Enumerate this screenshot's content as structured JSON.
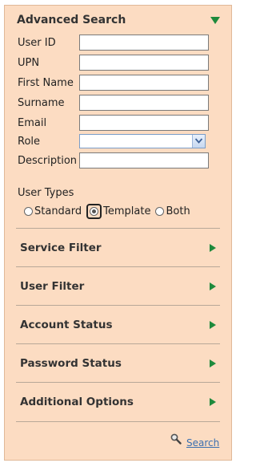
{
  "header": {
    "title": "Advanced Search"
  },
  "fields": [
    {
      "label": "User ID",
      "value": ""
    },
    {
      "label": "UPN",
      "value": ""
    },
    {
      "label": "First Name",
      "value": ""
    },
    {
      "label": "Surname",
      "value": ""
    },
    {
      "label": "Email",
      "value": ""
    }
  ],
  "role": {
    "label": "Role",
    "selected": ""
  },
  "description": {
    "label": "Description",
    "value": ""
  },
  "user_types": {
    "label": "User Types",
    "options": [
      "Standard",
      "Template",
      "Both"
    ],
    "selected": "Template"
  },
  "sections": [
    {
      "label": "Service Filter"
    },
    {
      "label": "User Filter"
    },
    {
      "label": "Account Status"
    },
    {
      "label": "Password Status"
    },
    {
      "label": "Additional Options"
    }
  ],
  "search": {
    "label": "Search",
    "icon": "magnifier-icon"
  },
  "colors": {
    "panel_bg": "#fcdcc2",
    "accent_green": "#1e8a3c",
    "link_blue": "#3a6fb0"
  }
}
